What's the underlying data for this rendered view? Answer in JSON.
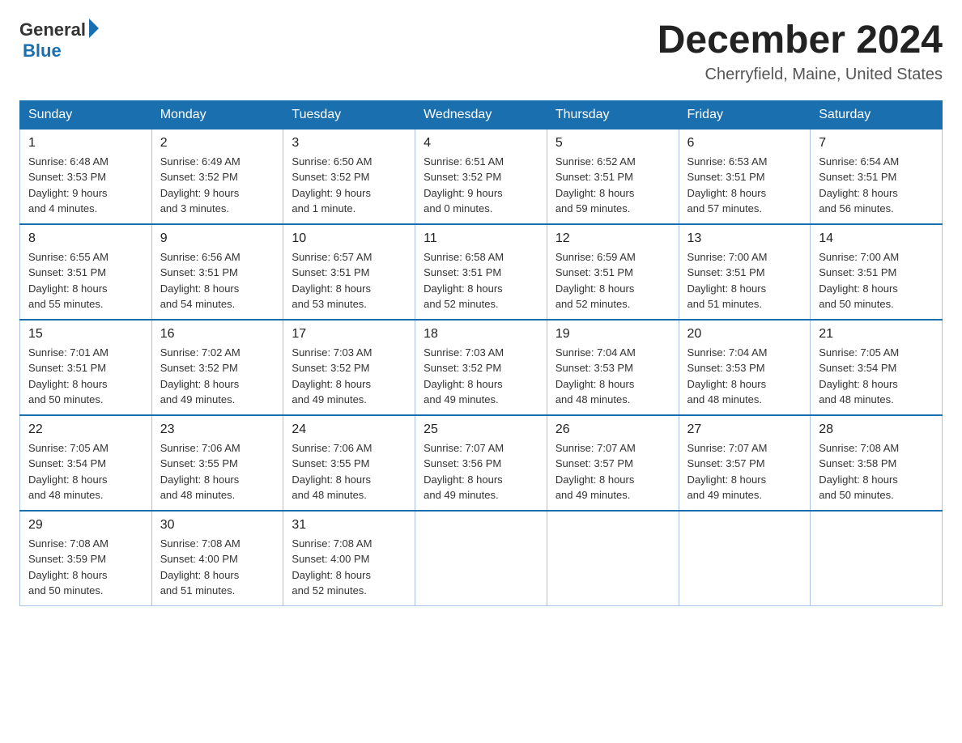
{
  "header": {
    "logo_general": "General",
    "logo_blue": "Blue",
    "title": "December 2024",
    "location": "Cherryfield, Maine, United States"
  },
  "days_of_week": [
    "Sunday",
    "Monday",
    "Tuesday",
    "Wednesday",
    "Thursday",
    "Friday",
    "Saturday"
  ],
  "weeks": [
    [
      {
        "num": "1",
        "sunrise": "6:48 AM",
        "sunset": "3:53 PM",
        "daylight": "9 hours and 4 minutes."
      },
      {
        "num": "2",
        "sunrise": "6:49 AM",
        "sunset": "3:52 PM",
        "daylight": "9 hours and 3 minutes."
      },
      {
        "num": "3",
        "sunrise": "6:50 AM",
        "sunset": "3:52 PM",
        "daylight": "9 hours and 1 minute."
      },
      {
        "num": "4",
        "sunrise": "6:51 AM",
        "sunset": "3:52 PM",
        "daylight": "9 hours and 0 minutes."
      },
      {
        "num": "5",
        "sunrise": "6:52 AM",
        "sunset": "3:51 PM",
        "daylight": "8 hours and 59 minutes."
      },
      {
        "num": "6",
        "sunrise": "6:53 AM",
        "sunset": "3:51 PM",
        "daylight": "8 hours and 57 minutes."
      },
      {
        "num": "7",
        "sunrise": "6:54 AM",
        "sunset": "3:51 PM",
        "daylight": "8 hours and 56 minutes."
      }
    ],
    [
      {
        "num": "8",
        "sunrise": "6:55 AM",
        "sunset": "3:51 PM",
        "daylight": "8 hours and 55 minutes."
      },
      {
        "num": "9",
        "sunrise": "6:56 AM",
        "sunset": "3:51 PM",
        "daylight": "8 hours and 54 minutes."
      },
      {
        "num": "10",
        "sunrise": "6:57 AM",
        "sunset": "3:51 PM",
        "daylight": "8 hours and 53 minutes."
      },
      {
        "num": "11",
        "sunrise": "6:58 AM",
        "sunset": "3:51 PM",
        "daylight": "8 hours and 52 minutes."
      },
      {
        "num": "12",
        "sunrise": "6:59 AM",
        "sunset": "3:51 PM",
        "daylight": "8 hours and 52 minutes."
      },
      {
        "num": "13",
        "sunrise": "7:00 AM",
        "sunset": "3:51 PM",
        "daylight": "8 hours and 51 minutes."
      },
      {
        "num": "14",
        "sunrise": "7:00 AM",
        "sunset": "3:51 PM",
        "daylight": "8 hours and 50 minutes."
      }
    ],
    [
      {
        "num": "15",
        "sunrise": "7:01 AM",
        "sunset": "3:51 PM",
        "daylight": "8 hours and 50 minutes."
      },
      {
        "num": "16",
        "sunrise": "7:02 AM",
        "sunset": "3:52 PM",
        "daylight": "8 hours and 49 minutes."
      },
      {
        "num": "17",
        "sunrise": "7:03 AM",
        "sunset": "3:52 PM",
        "daylight": "8 hours and 49 minutes."
      },
      {
        "num": "18",
        "sunrise": "7:03 AM",
        "sunset": "3:52 PM",
        "daylight": "8 hours and 49 minutes."
      },
      {
        "num": "19",
        "sunrise": "7:04 AM",
        "sunset": "3:53 PM",
        "daylight": "8 hours and 48 minutes."
      },
      {
        "num": "20",
        "sunrise": "7:04 AM",
        "sunset": "3:53 PM",
        "daylight": "8 hours and 48 minutes."
      },
      {
        "num": "21",
        "sunrise": "7:05 AM",
        "sunset": "3:54 PM",
        "daylight": "8 hours and 48 minutes."
      }
    ],
    [
      {
        "num": "22",
        "sunrise": "7:05 AM",
        "sunset": "3:54 PM",
        "daylight": "8 hours and 48 minutes."
      },
      {
        "num": "23",
        "sunrise": "7:06 AM",
        "sunset": "3:55 PM",
        "daylight": "8 hours and 48 minutes."
      },
      {
        "num": "24",
        "sunrise": "7:06 AM",
        "sunset": "3:55 PM",
        "daylight": "8 hours and 48 minutes."
      },
      {
        "num": "25",
        "sunrise": "7:07 AM",
        "sunset": "3:56 PM",
        "daylight": "8 hours and 49 minutes."
      },
      {
        "num": "26",
        "sunrise": "7:07 AM",
        "sunset": "3:57 PM",
        "daylight": "8 hours and 49 minutes."
      },
      {
        "num": "27",
        "sunrise": "7:07 AM",
        "sunset": "3:57 PM",
        "daylight": "8 hours and 49 minutes."
      },
      {
        "num": "28",
        "sunrise": "7:08 AM",
        "sunset": "3:58 PM",
        "daylight": "8 hours and 50 minutes."
      }
    ],
    [
      {
        "num": "29",
        "sunrise": "7:08 AM",
        "sunset": "3:59 PM",
        "daylight": "8 hours and 50 minutes."
      },
      {
        "num": "30",
        "sunrise": "7:08 AM",
        "sunset": "4:00 PM",
        "daylight": "8 hours and 51 minutes."
      },
      {
        "num": "31",
        "sunrise": "7:08 AM",
        "sunset": "4:00 PM",
        "daylight": "8 hours and 52 minutes."
      },
      null,
      null,
      null,
      null
    ]
  ],
  "labels": {
    "sunrise": "Sunrise:",
    "sunset": "Sunset:",
    "daylight": "Daylight:"
  }
}
